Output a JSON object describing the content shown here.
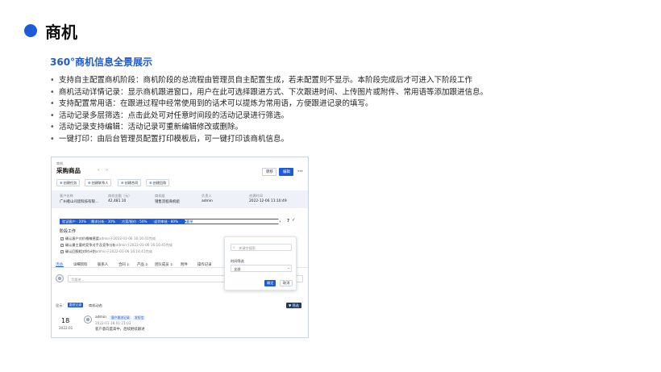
{
  "slide": {
    "title": "商机",
    "subheading": "360°商机信息全景展示",
    "bullets": [
      "支持自主配置商机阶段：商机阶段的总流程由管理员自主配置生成，若未配置则不显示。本阶段完成后才可进入下阶段工作",
      "商机活动详情记录：显示商机跟进窗口，用户在此可选择跟进方式、下次跟进时间、上传图片或附件、常用语等添加跟进信息。",
      "支持配置常用语：在跟进过程中经常使用到的话术可以提炼为常用语，方便跟进记录的填写。",
      "活动记录多层筛选：点击此处可对任意时间段的活动记录进行筛选。",
      "活动记录支持编辑：活动记录可重新编辑修改或删除。",
      "一键打印：由后台管理员配置打印模板后，可一键打印该商机信息。"
    ],
    "accent_color": "#1f5bd6"
  },
  "screenshot": {
    "breadcrumb": "商机",
    "record_title": "采购商品",
    "prev_icon": "‹",
    "next_icon": "›",
    "follow_label": "转移",
    "edit_label": "编辑",
    "more_label": "···",
    "actions": [
      {
        "icon": "⊕",
        "label": "创建任务"
      },
      {
        "icon": "⊕",
        "label": "创建联系人"
      },
      {
        "icon": "⊕",
        "label": "创建合同"
      },
      {
        "icon": "⊕",
        "label": "创建回款"
      }
    ],
    "info": [
      {
        "label": "客户名称",
        "value": "广州者山司思科技有限..."
      },
      {
        "label": "商机金额（元）",
        "value": "42,481.10"
      },
      {
        "label": "商机组",
        "value": "销售流程商机组"
      },
      {
        "label": "负责人",
        "value": "admin"
      },
      {
        "label": "创建时间",
        "value": "2022-12-06 11:10:49"
      }
    ],
    "stages": [
      {
        "label": "验证客户 · 20%",
        "state": "done"
      },
      {
        "label": "需求分析 · 30%",
        "state": "done"
      },
      {
        "label": "方案/报价 · 50%",
        "state": "done"
      },
      {
        "label": "谈判审核 · 80%",
        "state": "current"
      },
      {
        "label": "赢单",
        "state": "future"
      }
    ],
    "stage_help_icon": "?",
    "stage_check_icon": "✓",
    "stage_work_title": "阶段工作",
    "tasks": [
      {
        "text": "确认客户对价格敏感度",
        "meta": "admin于2022-01-06 16:16:41完成"
      },
      {
        "text": "确认最主要的竞争对手及竞争分析",
        "meta": "admin于2022-01-06 16:16:45完成"
      },
      {
        "text": "确认回报相对时计划",
        "meta": "admin于2022-01-06 16:14:41完成"
      }
    ],
    "tabs": [
      {
        "label": "活动",
        "count": ""
      },
      {
        "label": "详细资料",
        "count": ""
      },
      {
        "label": "联系人",
        "count": ""
      },
      {
        "label": "合同",
        "count": "1"
      },
      {
        "label": "产品",
        "count": "2"
      },
      {
        "label": "团队成员",
        "count": "1"
      },
      {
        "label": "附件",
        "count": ""
      },
      {
        "label": "操作记录",
        "count": ""
      }
    ],
    "comment_placeholder": "写跟进...",
    "show_label": "显示:",
    "filter_tags": [
      {
        "label": "跟进记录",
        "style": "blue"
      },
      {
        "label": "商机动态",
        "style": "plain"
      }
    ],
    "filter_button": "▼ 筛选",
    "entry": {
      "day": "18",
      "year_month": "2022.01",
      "user": "admin",
      "tags": [
        "客户跟进记录",
        "发短信"
      ],
      "time": "2022-01-18 01:21:03",
      "content": "客户意向度高中，后续继续跟进"
    },
    "popover": {
      "search_placeholder": "关键字搜索",
      "time_filter_label": "时间筛选",
      "time_filter_value": "全部",
      "ok_label": "确定",
      "cancel_label": "取消",
      "search_icon": "⌕",
      "dropdown_icon": "⌄"
    }
  }
}
